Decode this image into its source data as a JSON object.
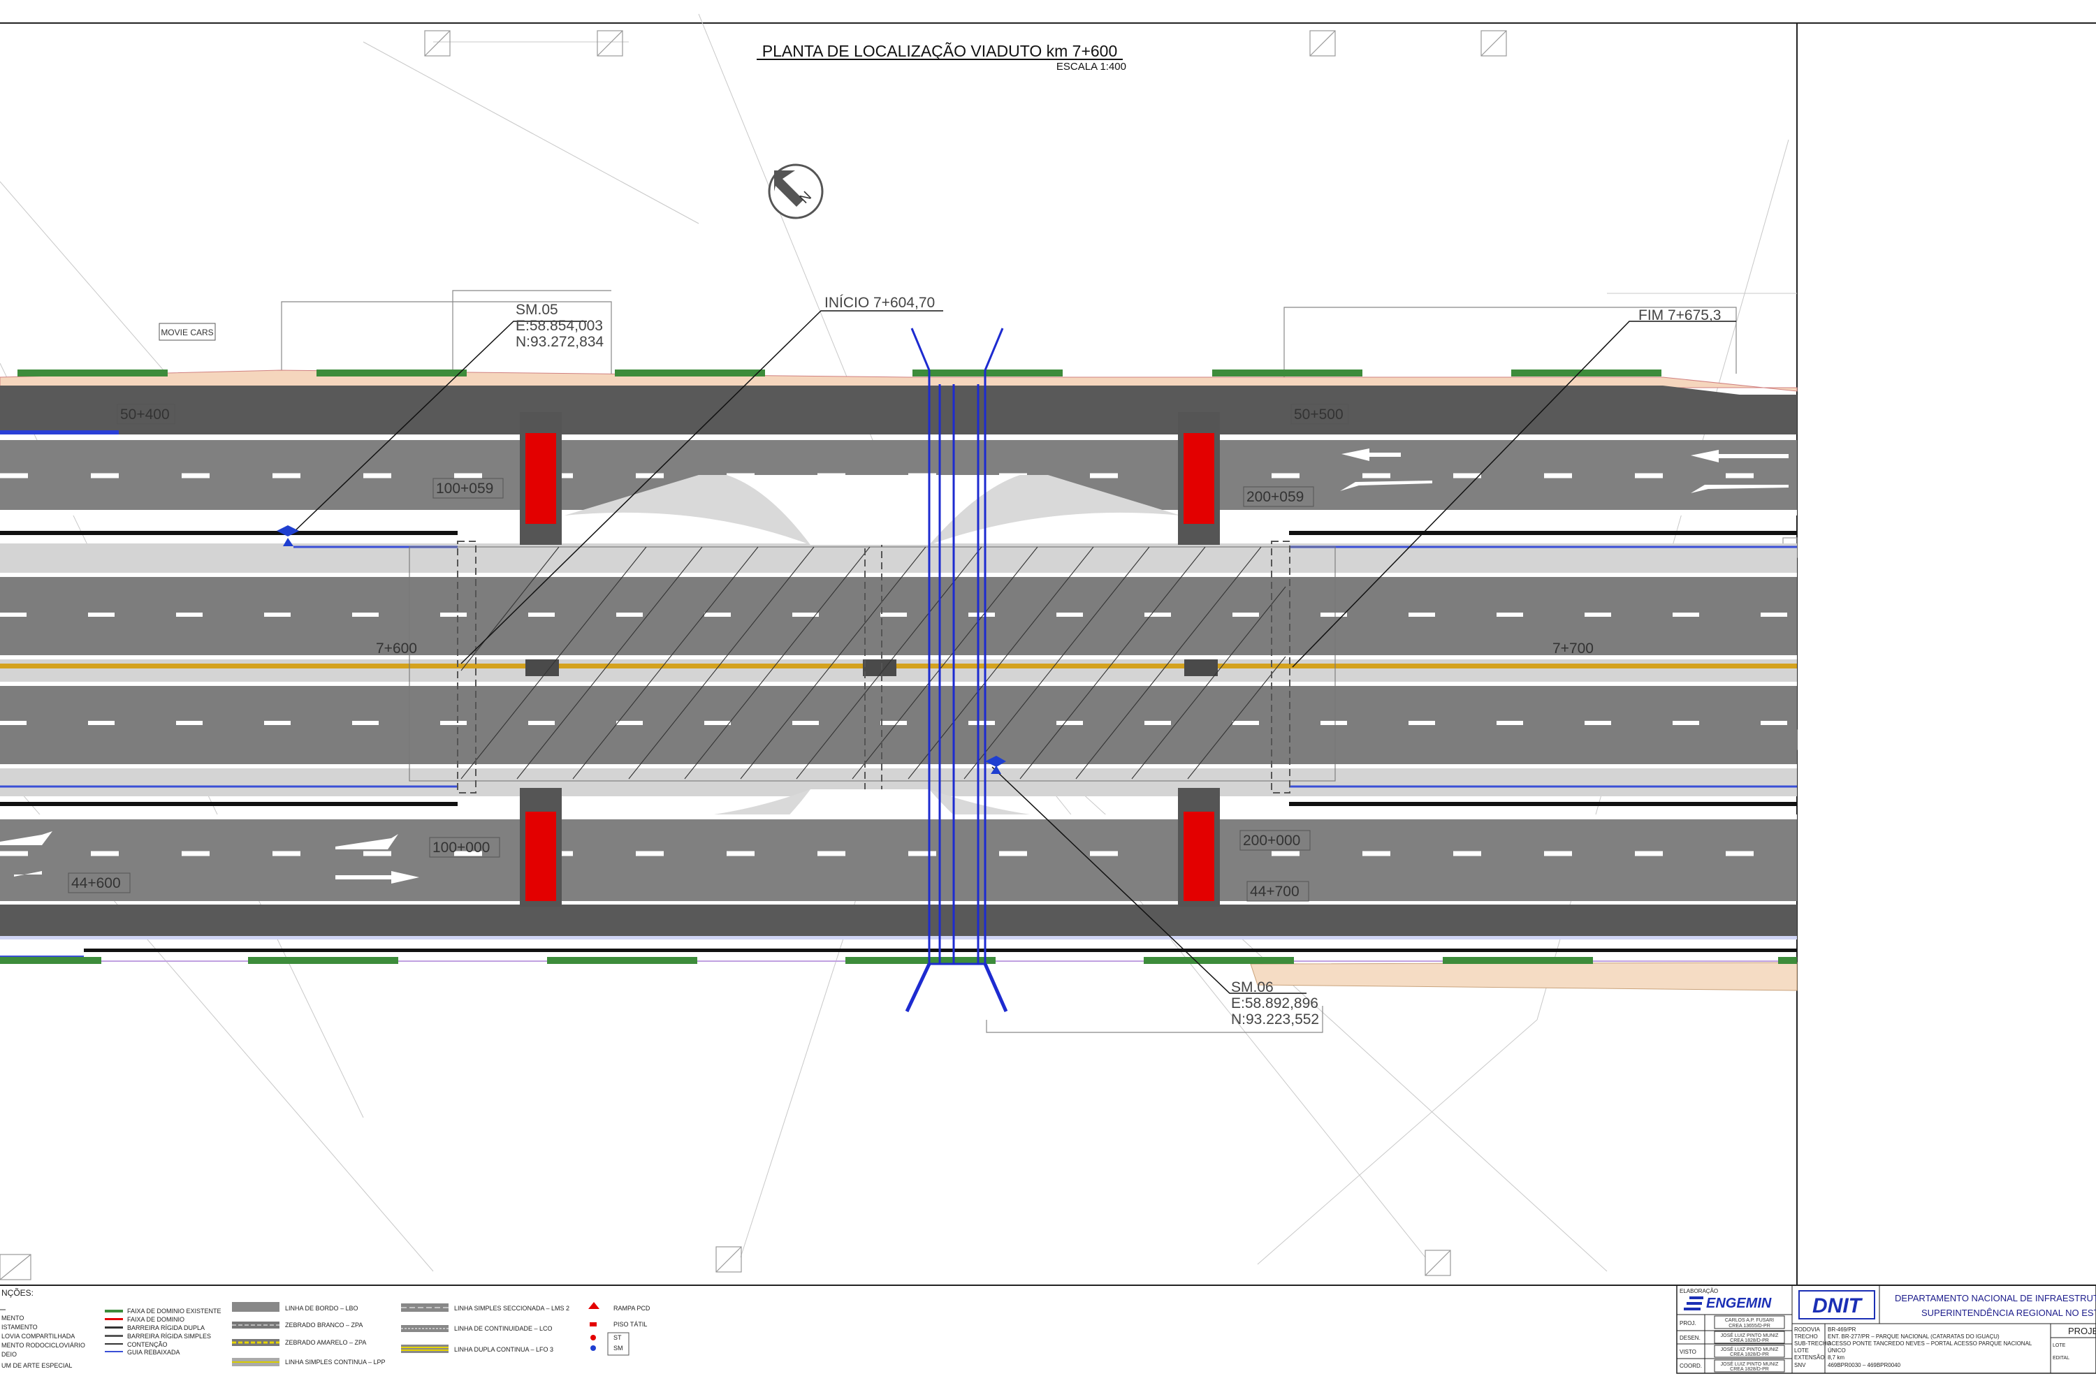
{
  "drawing": {
    "title": "PLANTA DE LOCALIZAÇÃO VIADUTO km 7+600",
    "scale": "ESCALA 1:400",
    "north": "N",
    "sign_label": "MOVIE CARS"
  },
  "stations": {
    "s50_400": "50+400",
    "s50_500": "50+500",
    "s100_059": "100+059",
    "s200_059": "200+059",
    "s7_600": "7+600",
    "s7_700": "7+700",
    "s100_000": "100+000",
    "s200_000": "200+000",
    "s44_600": "44+600",
    "s44_700": "44+700"
  },
  "callouts": {
    "inicio": "INÍCIO  7+604,70",
    "fim": "FIM  7+675,3",
    "sm05": {
      "name": "SM.05",
      "e": "E:58.854,003",
      "n": "N:93.272,834"
    },
    "sm06": {
      "name": "SM.06",
      "e": "E:58.892,896",
      "n": "N:93.223,552"
    }
  },
  "legend": {
    "heading": "NÇÕES:",
    "col1": [
      "MENTO",
      "ISTAMENTO",
      "LOVIA COMPARTILHADA",
      "MENTO RODOCICLOVIÁRIO",
      "DEIO",
      "UM DE ARTE ESPECIAL"
    ],
    "col2": [
      "FAIXA DE DOMINIO EXISTENTE",
      "FAIXA DE DOMINIO",
      "BARREIRA RÍGIDA DUPLA",
      "BARREIRA RÍGIDA SIMPLES",
      "CONTENÇÃO",
      "GUIA REBAIXADA"
    ],
    "col3": [
      "LINHA DE BORDO – LBO",
      "ZEBRADO BRANCO – ZPA",
      "ZEBRADO AMARELO – ZPA",
      "LINHA SIMPLES CONTINUA – LPP"
    ],
    "col4": [
      "LINHA SIMPLES SECCIONADA – LMS 2",
      "LINHA DE CONTINUIDADE – LCO",
      "LINHA DUPLA CONTINUA – LFO 3"
    ],
    "col5": [
      "RAMPA PCD",
      "PISO TÁTIL",
      "ST",
      "SM"
    ]
  },
  "titleblock": {
    "elaboracao": "ELABORAÇÃO",
    "engemin": "ENGEMIN",
    "proj": "PROJ.",
    "desen": "DESEN.",
    "visto": "VISTO",
    "coord": "COORD.",
    "name1": "CARLOS A.P. FUSARI",
    "crea1": "CREA 13655/D-PR",
    "name2": "JOSÉ LUIZ PINTO MUNIZ",
    "crea2": "CREA 1828/D-PR",
    "name3": "JOSÉ LUIZ PINTO MUNIZ",
    "crea3": "CREA 1828/D-PR",
    "name4": "JOSÉ LUIZ PINTO MUNIZ",
    "crea4": "CREA 1828/D-PR",
    "dnit": "DNIT",
    "dept": "DEPARTAMENTO NACIONAL DE INFRAESTRUTU",
    "superint": "SUPERINTENDÊNCIA REGIONAL NO ESTA",
    "rows": [
      "RODOVIA",
      "TRECHO",
      "SUB-TRECHO",
      "LOTE",
      "EXTENSÃO",
      "SNV"
    ],
    "values": [
      "BR-469/PR",
      "ENT. BR-277/PR – PARQUE NACIONAL (CATARATAS DO IGUAÇU)",
      "ACESSO PONTE TANCREDO NEVES – PORTAL ACESSO PARQUE NACIONAL",
      "ÚNICO",
      "8,7 km",
      "469BPR0030 – 469BPR0040"
    ],
    "proj_tab": "PROJE",
    "small1": "LOTE",
    "small2": "EDITAL"
  }
}
